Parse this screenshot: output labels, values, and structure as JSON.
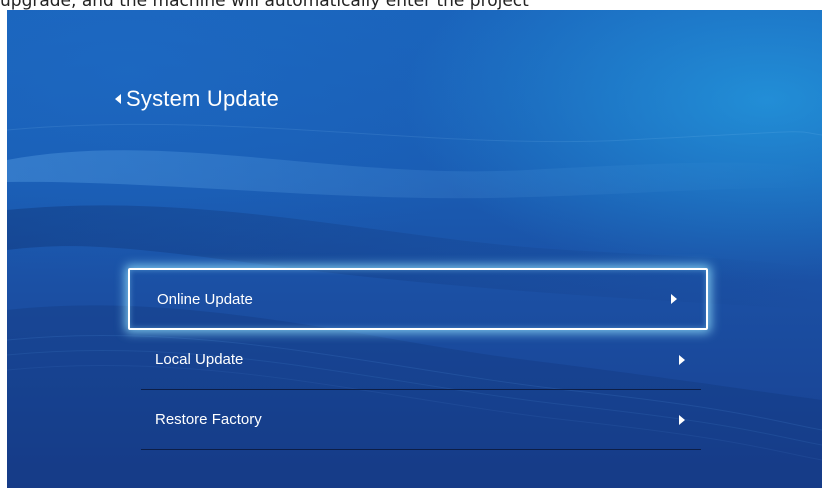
{
  "top_caption": "upgrade, and the machine will automatically enter the project",
  "header": {
    "title": "System Update",
    "back_icon": "back-arrow-icon"
  },
  "menu": {
    "items": [
      {
        "label": "Online Update",
        "selected": true,
        "icon": "chevron-right-icon"
      },
      {
        "label": "Local Update",
        "selected": false,
        "icon": "chevron-right-icon"
      },
      {
        "label": "Restore Factory",
        "selected": false,
        "icon": "chevron-right-icon"
      }
    ]
  },
  "colors": {
    "background_top": "#1a63bb",
    "background_bottom": "#183f8f",
    "highlight_glow": "#96e6ff",
    "text": "#ffffff"
  }
}
